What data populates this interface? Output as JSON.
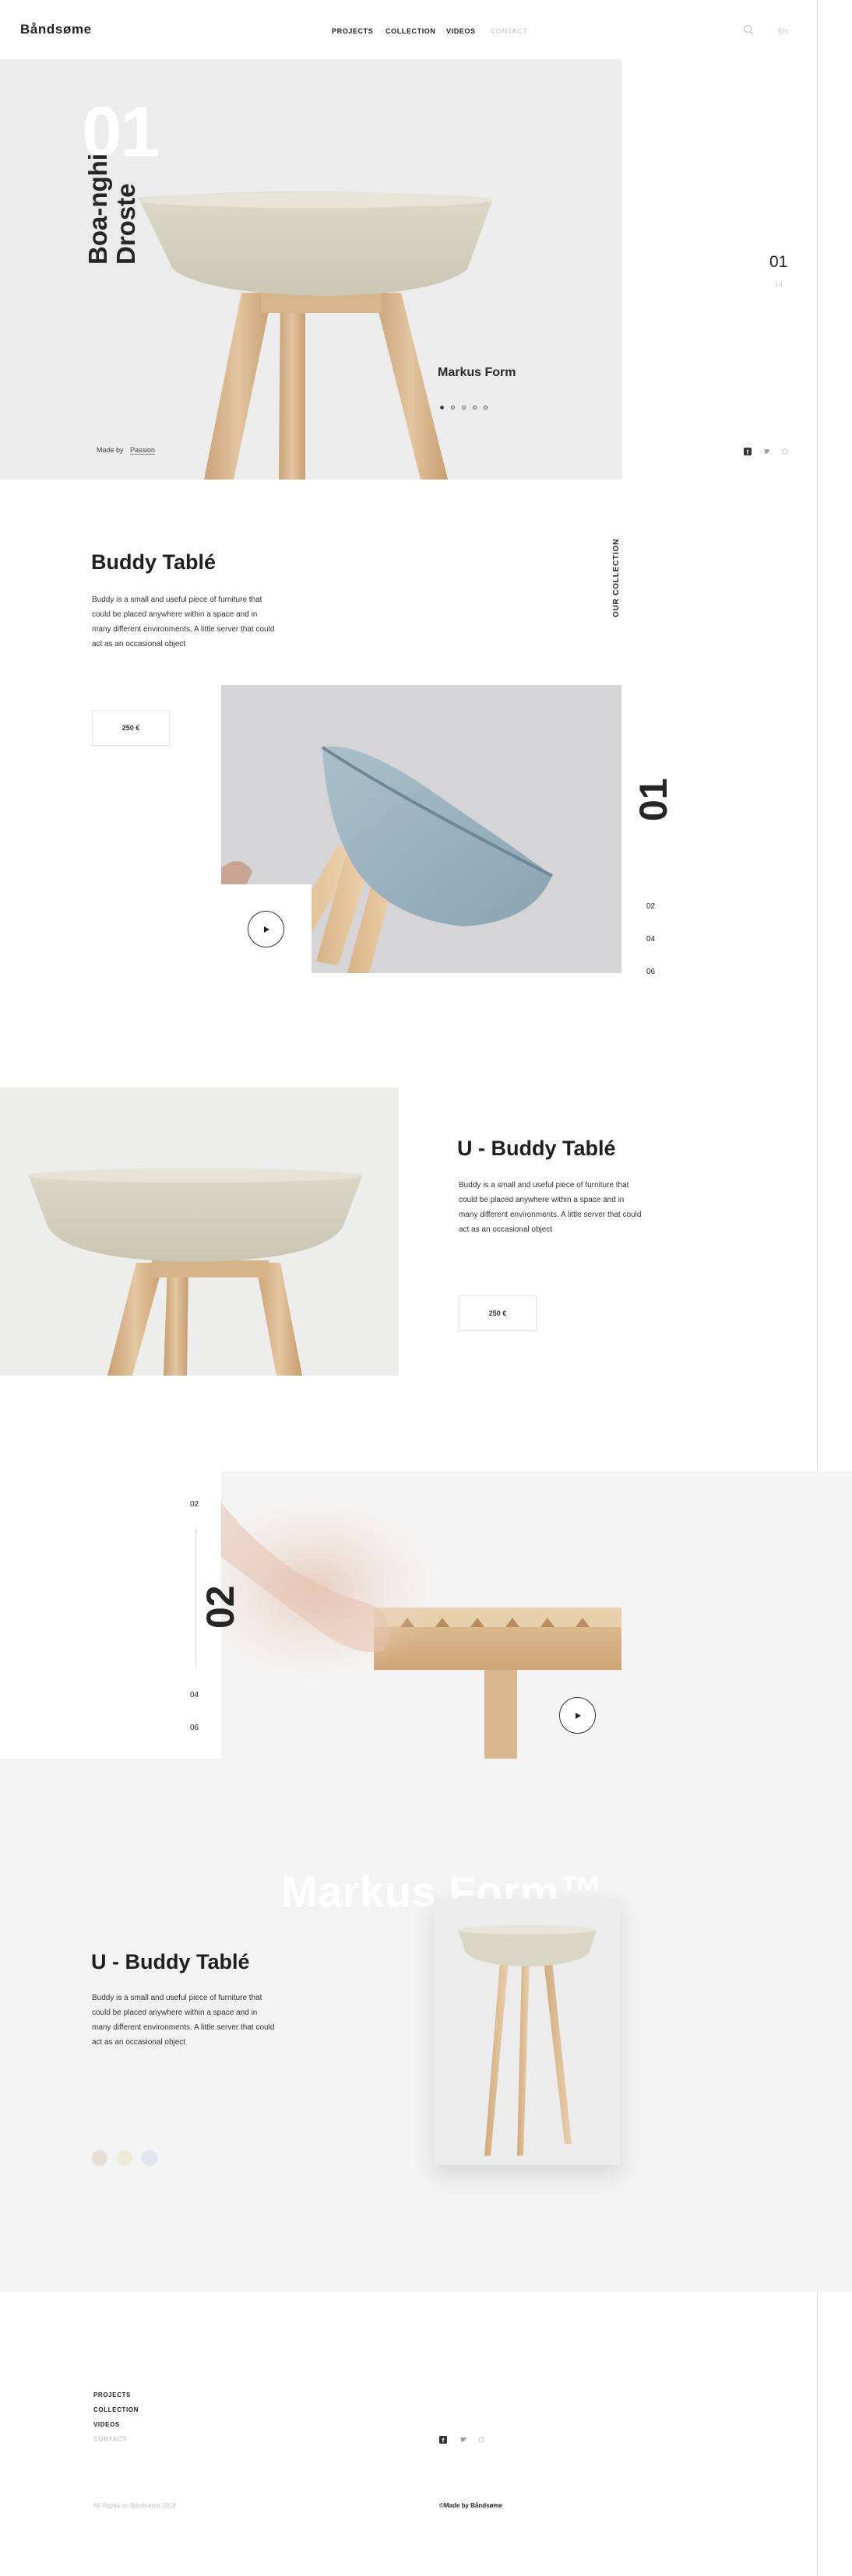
{
  "brand": {
    "logo": "Båndsøme"
  },
  "header": {
    "nav": [
      {
        "label": "PROJECTS"
      },
      {
        "label": "COLLECTION"
      },
      {
        "label": "VIDEOS"
      },
      {
        "label": "CONTACT"
      }
    ],
    "lang": "EN"
  },
  "hero": {
    "number": "01",
    "name_line1": "Boa-nghi",
    "name_line2": "Droste",
    "subtitle": "Markus Form",
    "made_by_label": "Made by",
    "made_by_value": "Passion",
    "slide_current": "01",
    "slide_total": "14",
    "dots_total": 5,
    "dots_active": 1
  },
  "social": {
    "facebook": "f",
    "twitter": "t",
    "other": "+"
  },
  "section1": {
    "title": "Buddy Tablé",
    "description": "Buddy is a small and useful piece of furniture that could be placed anywhere within a space and in many different environments. A little server that could act as an occasional object",
    "price": "250 €",
    "collection_label": "OUR COLLECTION",
    "big_number": "01",
    "nums": [
      "02",
      "04",
      "06"
    ]
  },
  "section2": {
    "title": "U - Buddy Tablé",
    "description": "Buddy is a small and useful piece of furniture that could be placed anywhere within a space and in many different environments. A little server that could act as an occasional object",
    "price": "250 €"
  },
  "section3": {
    "big_number": "02",
    "num_top": "02",
    "nums_bottom": [
      "04",
      "06"
    ]
  },
  "section4": {
    "watermark": "Markus Form™",
    "title": "U - Buddy Tablé",
    "description": "Buddy is a small and useful piece of furniture that could be placed anywhere within a space and in many different environments. A little server that could act as an occasional object",
    "swatches": [
      "#e9ded3",
      "#f0ead8",
      "#dde4ef"
    ]
  },
  "footer": {
    "nav": [
      {
        "label": "PROJECTS"
      },
      {
        "label": "COLLECTION"
      },
      {
        "label": "VIDEOS"
      },
      {
        "label": "CONTACT"
      }
    ],
    "copyright": "All Rights on Båndsøme 2018",
    "made_by": "©Made by Båndsøme"
  }
}
